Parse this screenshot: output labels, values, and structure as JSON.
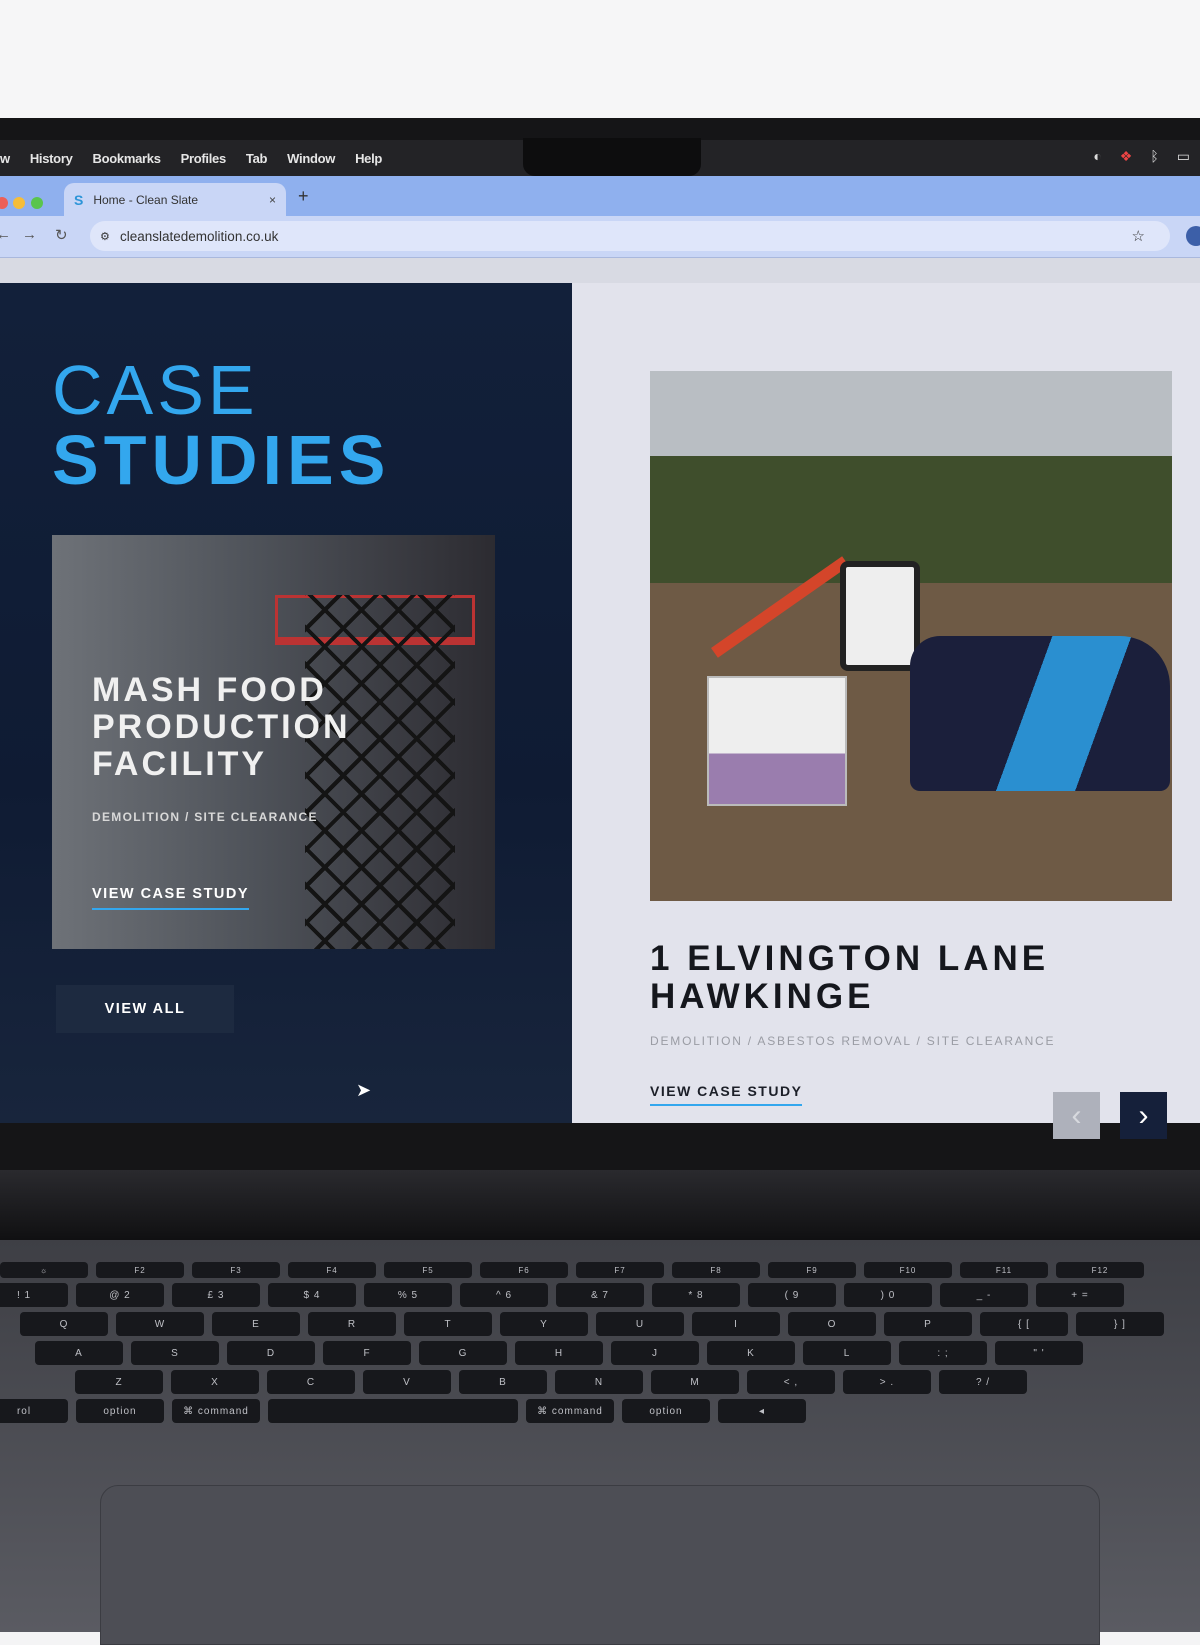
{
  "menubar": {
    "items": [
      "w",
      "History",
      "Bookmarks",
      "Profiles",
      "Tab",
      "Window",
      "Help"
    ]
  },
  "browser": {
    "tab_title": "Home - Clean Slate",
    "tab_close": "×",
    "new_tab": "+",
    "url": "cleanslatedemolition.co.uk",
    "back": "←",
    "forward": "→",
    "reload": "↻",
    "bookmark": "☆",
    "traffic_lights": [
      "#ec5f57",
      "#f5bd39",
      "#5ac54d"
    ]
  },
  "page": {
    "heading_line1": "CASE",
    "heading_line2": "STUDIES",
    "featured": {
      "title": "MASH FOOD PRODUCTION FACILITY",
      "categories": "DEMOLITION / SITE CLEARANCE",
      "link": "VIEW CASE STUDY"
    },
    "view_all": "VIEW ALL",
    "slide": {
      "title_line1": "1 ELVINGTON LANE",
      "title_line2": "HAWKINGE",
      "categories": "DEMOLITION / ASBESTOS REMOVAL / SITE CLEARANCE",
      "link": "VIEW CASE STUDY"
    },
    "prev": "‹",
    "next": "›",
    "colors": {
      "accent": "#33a7ee",
      "navy": "#12203a"
    }
  },
  "keyboard": {
    "fn_row": [
      "☼",
      "F2",
      "F3",
      "F4",
      "F5",
      "F6",
      "F7",
      "F8",
      "F9",
      "F10",
      "F11",
      "F12"
    ],
    "number_row": [
      "! 1",
      "@ 2",
      "£ 3",
      "$ 4",
      "% 5",
      "^ 6",
      "& 7",
      "* 8",
      "( 9",
      ") 0",
      "_ -",
      "+ ="
    ],
    "qwerty_row": [
      "Q",
      "W",
      "E",
      "R",
      "T",
      "Y",
      "U",
      "I",
      "O",
      "P",
      "{ [",
      "} ]"
    ],
    "home_row": [
      "A",
      "S",
      "D",
      "F",
      "G",
      "H",
      "J",
      "K",
      "L",
      ": ;",
      "\" '"
    ],
    "bottom_row": [
      "Z",
      "X",
      "C",
      "V",
      "B",
      "N",
      "M",
      "< ,",
      "> .",
      "? /"
    ],
    "modifier_row": [
      "rol",
      "option",
      "⌘ command",
      "",
      "⌘ command",
      "option",
      "◂"
    ]
  }
}
